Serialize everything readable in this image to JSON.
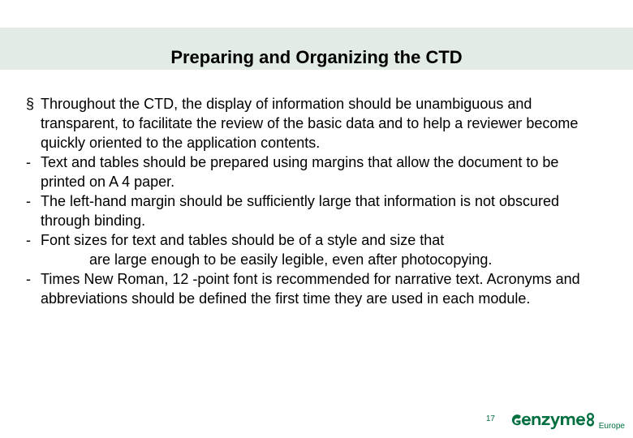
{
  "title": "Preparing and Organizing the CTD",
  "bullets": [
    {
      "marker": "§",
      "text": "Throughout the CTD, the display of information should be unambiguous and transparent, to facilitate the review of the basic data and to help a reviewer become quickly oriented to the application contents."
    },
    {
      "marker": "-",
      "text": "Text and tables should be prepared using margins that allow the document to be printed on A 4 paper."
    },
    {
      "marker": "-",
      "text": "The left-hand margin should be sufficiently large that information is not obscured through binding."
    },
    {
      "marker": "-",
      "text_before": "Font sizes for text and tables should be of a style and size that",
      "text_indent": "are large enough to be easily legible, even after photocopying."
    },
    {
      "marker": "-",
      "text": "Times New Roman, 12 -point font is recommended for narrative text. Acronyms and abbreviations should be defined the first time they are used in each module."
    }
  ],
  "page_number": "17",
  "brand": {
    "name": "genzyme",
    "region": "Europe",
    "color": "#006f3f"
  }
}
